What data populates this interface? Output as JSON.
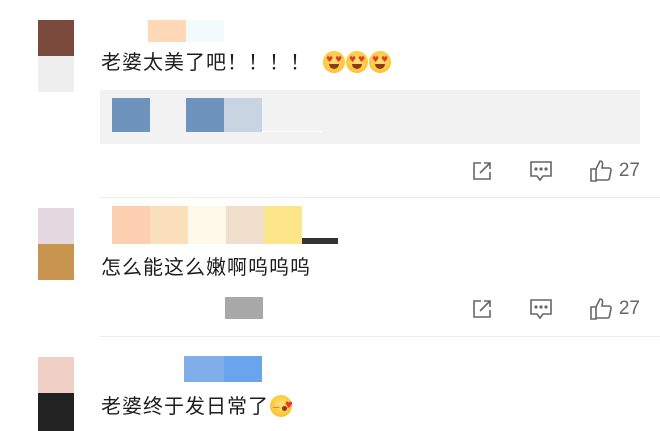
{
  "comments": [
    {
      "text": "老婆太美了吧！！！！",
      "emoji": [
        "heart-eyes-emoji",
        "heart-eyes-emoji",
        "heart-eyes-emoji"
      ],
      "like_count": "27"
    },
    {
      "text": "怎么能这么嫩啊呜呜呜",
      "like_count": "27"
    },
    {
      "text": "老婆终于发日常了",
      "emoji": [
        "kiss-emoji"
      ]
    }
  ],
  "icons": {
    "share": "share-icon",
    "reply": "reply-icon",
    "like": "thumbs-up-icon"
  },
  "colors": {
    "text": "#1d1d1d",
    "action_gray": "#666666",
    "quote_bg": "#f2f2f2",
    "divider": "#ececec"
  }
}
